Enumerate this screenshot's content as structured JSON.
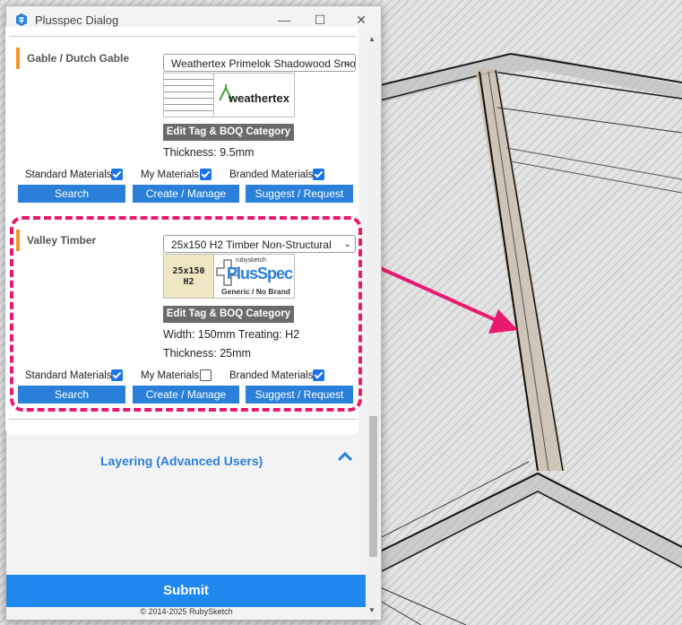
{
  "window": {
    "title": "Plusspec Dialog",
    "minimize": "—",
    "maximize": "☐",
    "close": "✕"
  },
  "gable": {
    "label": "Gable / Dutch Gable",
    "selected": "Weathertex Primelok Shadowood Smooth",
    "brand_logo": "weathertex",
    "edit_label": "Edit Tag & BOQ Category",
    "thickness": "Thickness: 9.5mm",
    "std_materials": "Standard Materials",
    "my_materials": "My Materials",
    "branded_materials": "Branded Materials",
    "std_checked": true,
    "my_checked": true,
    "branded_checked": true,
    "search": "Search",
    "create": "Create / Manage",
    "suggest": "Suggest / Request"
  },
  "valley": {
    "label": "Valley Timber",
    "selected": "25x150 H2 Timber Non-Structural",
    "thumb_line1": "25x150",
    "thumb_line2": "H2",
    "logo_small": "rubysketch",
    "logo_main": "PlusSpec",
    "logo_caption": "Generic / No Brand",
    "edit_label": "Edit Tag & BOQ Category",
    "dims": "Width: 150mm Treating: H2",
    "thickness": "Thickness: 25mm",
    "std_materials": "Standard Materials",
    "my_materials": "My Materials",
    "branded_materials": "Branded Materials",
    "std_checked": true,
    "my_checked": false,
    "branded_checked": true,
    "search": "Search",
    "create": "Create / Manage",
    "suggest": "Suggest / Request"
  },
  "layering": {
    "label": "Layering (Advanced Users)"
  },
  "footer": {
    "submit": "Submit",
    "copyright": "© 2014-2025 RubySketch"
  },
  "colors": {
    "accent_blue": "#2a80d9",
    "submit_blue": "#1f88ee",
    "section_orange": "#f7941d",
    "highlight_pink": "#e8196e"
  },
  "icons": [
    "plusspec-app-icon",
    "chevron-down-icon",
    "chevron-up-icon",
    "checkbox-icon",
    "arrow-annotation"
  ]
}
